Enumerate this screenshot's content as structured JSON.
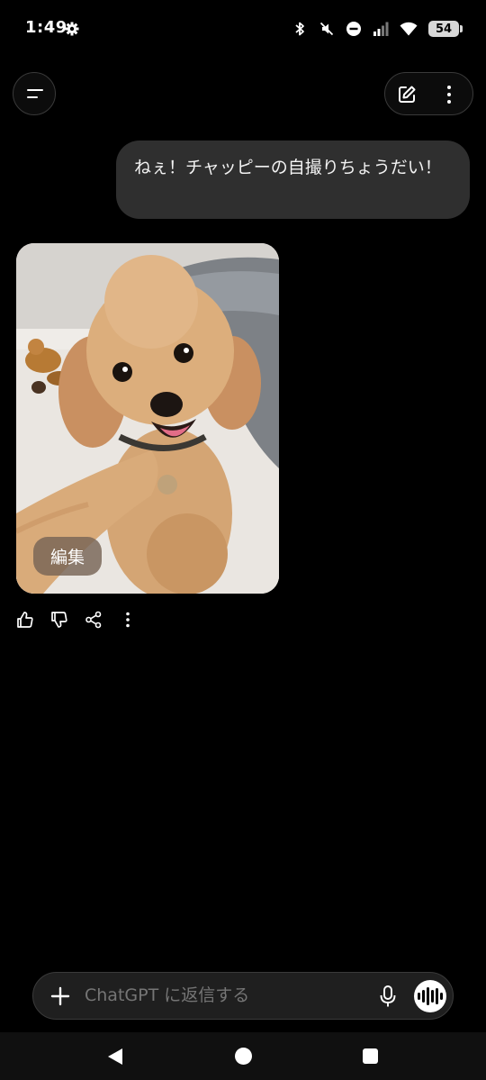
{
  "status_bar": {
    "time": "1:49",
    "battery": "54",
    "icons": [
      "gear-icon",
      "bluetooth-icon",
      "mute-icon",
      "dnd-icon",
      "signal-icon",
      "wifi-icon",
      "battery-icon"
    ]
  },
  "header": {
    "menu_icon": "menu-icon",
    "compose_icon": "new-chat-icon",
    "more_icon": "more-vertical-icon"
  },
  "conversation": {
    "user_message": "ねぇ！チャッピーの自撮りちょうだい！",
    "assistant_image": {
      "edit_label": "編集"
    },
    "feedback_icons": [
      "thumbs-up-icon",
      "thumbs-down-icon",
      "share-icon",
      "more-vertical-icon"
    ]
  },
  "composer": {
    "placeholder": "ChatGPT に返信する",
    "icons": [
      "plus-icon",
      "mic-icon",
      "voice-mode-icon"
    ]
  },
  "nav_bar": {
    "icons": [
      "back-icon",
      "home-icon",
      "recents-icon"
    ]
  },
  "colors": {
    "background": "#000000",
    "bubble": "#2f2f2f",
    "composer": "#1f1f1f"
  }
}
